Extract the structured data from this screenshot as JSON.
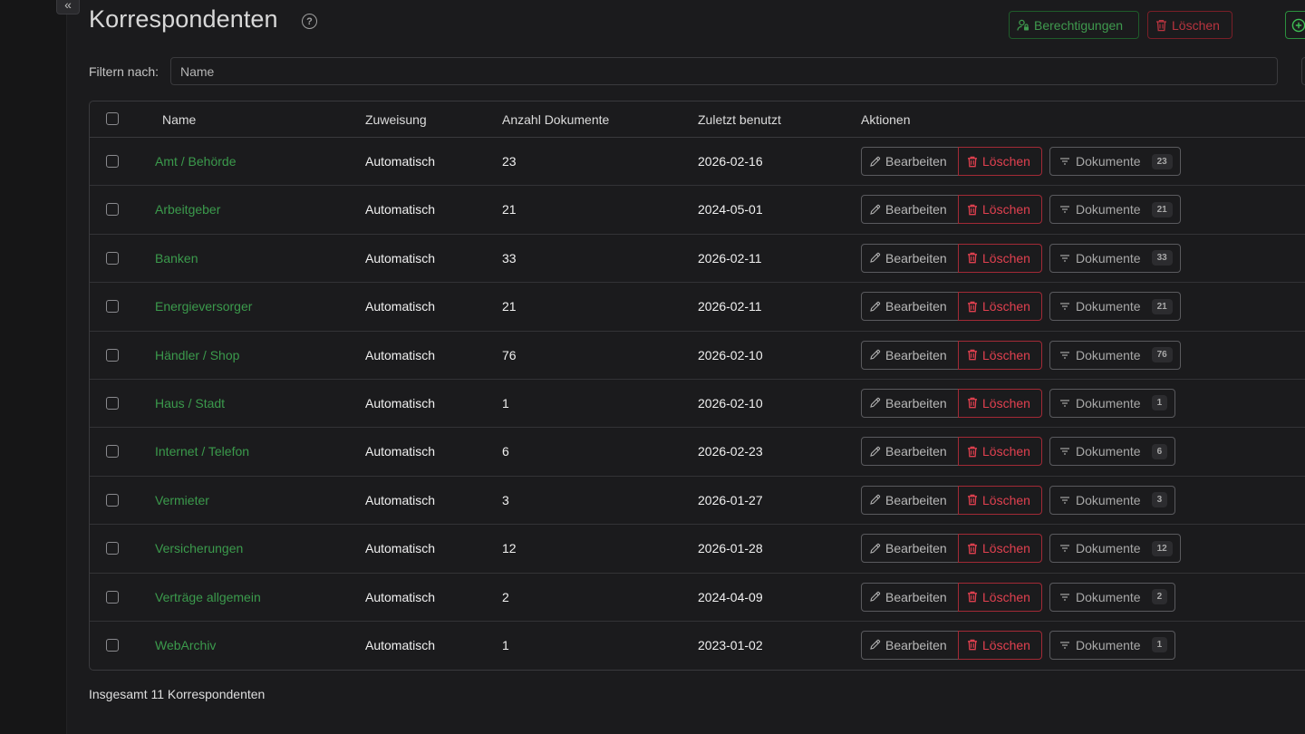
{
  "page": {
    "title": "Korrespondenten",
    "help_icon": "question-circle-icon"
  },
  "header_actions": {
    "permissions_label": "Berechtigungen",
    "delete_label": "Löschen",
    "add_icon": "plus-circle-icon"
  },
  "filter": {
    "label": "Filtern nach:",
    "placeholder": "Name",
    "value": ""
  },
  "table": {
    "columns": [
      "Name",
      "Zuweisung",
      "Anzahl Dokumente",
      "Zuletzt benutzt",
      "Aktionen"
    ],
    "action_labels": {
      "edit": "Bearbeiten",
      "delete": "Löschen",
      "documents": "Dokumente"
    },
    "rows": [
      {
        "name": "Amt / Behörde",
        "assignment": "Automatisch",
        "count": "23",
        "last_used": "2026-02-16"
      },
      {
        "name": "Arbeitgeber",
        "assignment": "Automatisch",
        "count": "21",
        "last_used": "2024-05-01"
      },
      {
        "name": "Banken",
        "assignment": "Automatisch",
        "count": "33",
        "last_used": "2026-02-11"
      },
      {
        "name": "Energieversorger",
        "assignment": "Automatisch",
        "count": "21",
        "last_used": "2026-02-11"
      },
      {
        "name": "Händler / Shop",
        "assignment": "Automatisch",
        "count": "76",
        "last_used": "2026-02-10"
      },
      {
        "name": "Haus / Stadt",
        "assignment": "Automatisch",
        "count": "1",
        "last_used": "2026-02-10"
      },
      {
        "name": "Internet / Telefon",
        "assignment": "Automatisch",
        "count": "6",
        "last_used": "2026-02-23"
      },
      {
        "name": "Vermieter",
        "assignment": "Automatisch",
        "count": "3",
        "last_used": "2026-01-27"
      },
      {
        "name": "Versicherungen",
        "assignment": "Automatisch",
        "count": "12",
        "last_used": "2026-01-28"
      },
      {
        "name": "Verträge allgemein",
        "assignment": "Automatisch",
        "count": "2",
        "last_used": "2024-04-09"
      },
      {
        "name": "WebArchiv",
        "assignment": "Automatisch",
        "count": "1",
        "last_used": "2023-01-02"
      }
    ]
  },
  "footer": {
    "total": "Insgesamt 11 Korrespondenten"
  },
  "icons": {
    "collapse": "chevron-double-left-icon",
    "edit": "pencil-icon",
    "delete": "trash-icon",
    "documents": "filter-icon",
    "permissions": "user-lock-icon"
  },
  "colors": {
    "accent_green": "#3b9a4c",
    "danger_red": "#e0404f",
    "background": "#1b1b1d"
  }
}
